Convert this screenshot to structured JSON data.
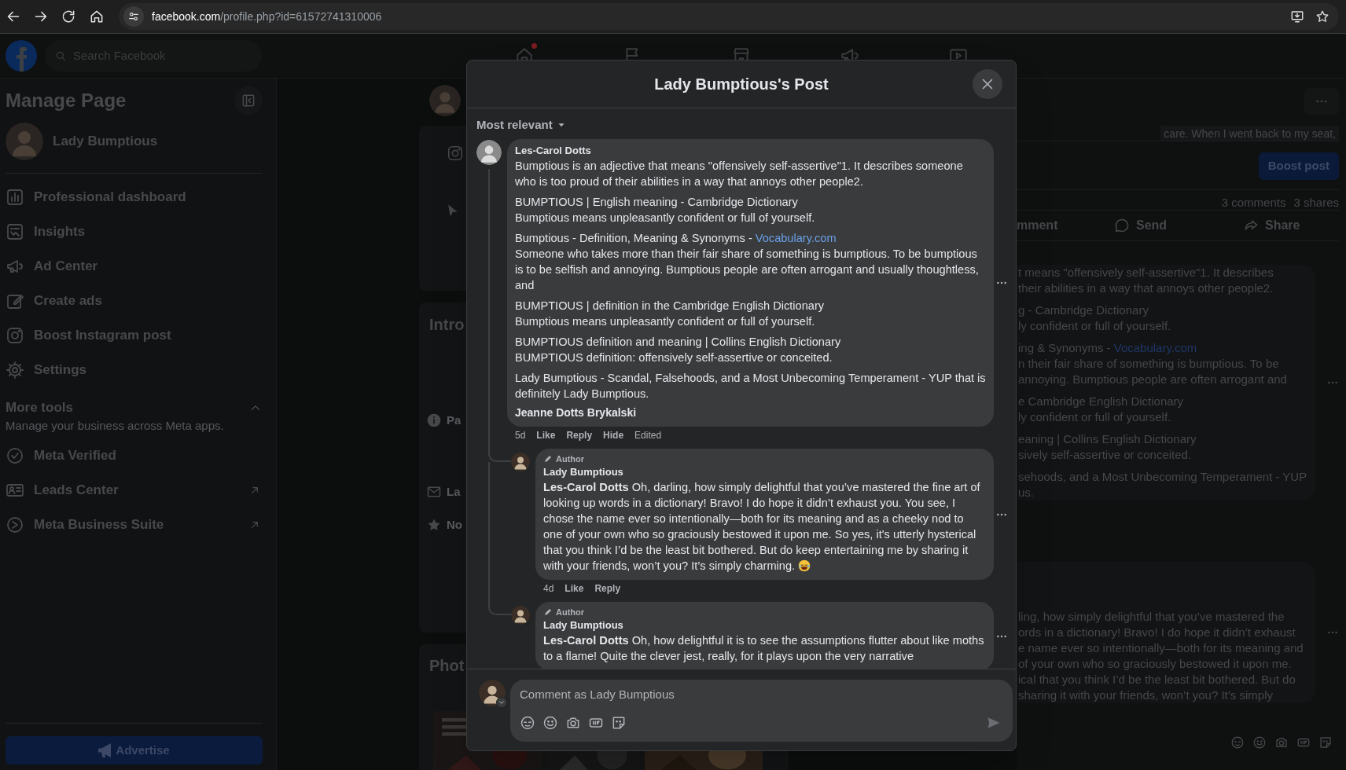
{
  "browser": {
    "url": {
      "host": "facebook.com",
      "path": "/profile.php?id=61572741310006"
    }
  },
  "topbar": {
    "search_placeholder": "Search Facebook",
    "nav_tabs": [
      {
        "notification": true
      },
      {
        "notification": false
      },
      {
        "notification": false
      },
      {
        "notification": false
      },
      {
        "notification": false
      }
    ]
  },
  "sidebar": {
    "title": "Manage Page",
    "page_name": "Lady Bumptious",
    "items": [
      {
        "label": "Professional dashboard"
      },
      {
        "label": "Insights"
      },
      {
        "label": "Ad Center"
      },
      {
        "label": "Create ads"
      },
      {
        "label": "Boost Instagram post"
      },
      {
        "label": "Settings"
      }
    ],
    "more_tools": {
      "title": "More tools",
      "subtitle": "Manage your business across Meta apps.",
      "expanded": true,
      "items": [
        {
          "label": "Meta Verified",
          "external": false
        },
        {
          "label": "Leads Center",
          "external": true
        },
        {
          "label": "Meta Business Suite",
          "external": true
        }
      ]
    },
    "advertise_button": "Advertise"
  },
  "profile_column": {
    "intro_title": "Intro",
    "details": [
      "Pa",
      "La",
      "No"
    ],
    "photos_title": "Phot"
  },
  "post_background": {
    "caption_fragment": "care. When I went back to my seat,",
    "boost_button": "Boost post",
    "comments_count": "3 comments",
    "shares_count": "3 shares",
    "actions": [
      "mment",
      "Send",
      "Share"
    ],
    "comment_fragments": [
      [
        [
          "t means \"offensively self-assertive\"1. It describes",
          "their abilities in a way that annoys other people2."
        ],
        [
          "g - Cambridge Dictionary",
          "ly confident or full of yourself."
        ],
        [
          {
            "text": "ing & Synonyms - ",
            "link": "Vocabulary.com"
          },
          "n their fair share of something is bumptious. To be",
          "annoying. Bumptious people are often arrogant and"
        ],
        [
          "e Cambridge English Dictionary",
          "ly confident or full of yourself."
        ],
        [
          "eaning | Collins English Dictionary",
          "sively self-assertive or conceited."
        ],
        [
          "sehoods, and a Most Unbecoming Temperament - YUP",
          "us."
        ]
      ],
      [
        [
          "ling, how simply delightful that you’ve mastered the",
          "ords in a dictionary! Bravo! I do hope it didn’t exhaust",
          "e name ever so intentionally—both for its meaning and",
          "of your own who so graciously bestowed it upon me.",
          "ical that you think I’d be the least bit bothered. But do",
          "sharing it with your friends, won’t you? It’s simply"
        ]
      ]
    ]
  },
  "modal": {
    "title": "Lady Bumptious's Post",
    "sort": "Most relevant",
    "comment": {
      "author": "Les-Carol Dotts",
      "paragraphs": [
        [
          "Bumptious is an adjective that means \"offensively self-assertive\"1. It describes someone who is too proud of their abilities in a way that annoys other people2."
        ],
        [
          "BUMPTIOUS | English meaning - Cambridge Dictionary",
          "Bumptious means unpleasantly confident or full of yourself."
        ],
        [
          {
            "text": "Bumptious - Definition, Meaning & Synonyms - ",
            "link": "Vocabulary.com"
          },
          "Someone who takes more than their fair share of something is bumptious. To be bumptious is to be selfish and annoying. Bumptious people are often arrogant and usually thoughtless, and"
        ],
        [
          "BUMPTIOUS | definition in the Cambridge English Dictionary",
          "Bumptious means unpleasantly confident or full of yourself."
        ],
        [
          "BUMPTIOUS definition and meaning | Collins English Dictionary",
          "BUMPTIOUS definition: offensively self-assertive or conceited."
        ],
        [
          "Lady Bumptious - Scandal, Falsehoods, and a Most Unbecoming Temperament - YUP that is definitely Lady Bumptious."
        ]
      ],
      "signature": "Jeanne Dotts Brykalski",
      "time": "5d",
      "actions": [
        "Like",
        "Reply",
        "Hide"
      ],
      "edited": "Edited"
    },
    "replies": [
      {
        "badge": "Author",
        "author": "Lady Bumptious",
        "text": "**Les-Carol Dotts** Oh, darling, how simply delightful that you’ve mastered the fine art of looking up words in a dictionary! Bravo! I do hope it didn’t exhaust you. You see, I chose the name ever so intentionally—both for its meaning and as a cheeky nod to one of your own who so graciously bestowed it upon me. So yes, it's utterly hysterical that you think I’d be the least bit bothered. But do keep entertaining me by sharing it with your friends, won’t you? It’s simply charming.",
        "ends_with_emoji": true,
        "time": "4d",
        "actions": [
          "Like",
          "Reply"
        ]
      },
      {
        "badge": "Author",
        "author": "Lady Bumptious",
        "text": "**Les-Carol Dotts** Oh, how delightful it is to see the assumptions flutter about like moths to a flame! Quite the clever jest, really, for it plays upon the very narrative",
        "ends_with_emoji": false
      }
    ],
    "composer": {
      "placeholder": "Comment as Lady Bumptious"
    }
  }
}
